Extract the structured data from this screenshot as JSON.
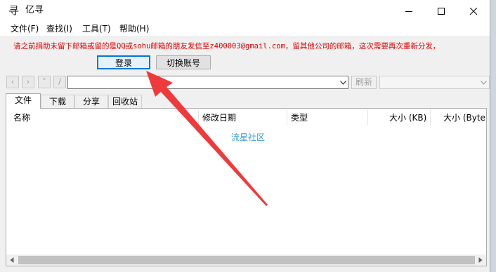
{
  "window": {
    "title": "亿寻",
    "icon": "app-logo-icon"
  },
  "window_controls": {
    "minimize": "minimize-icon",
    "maximize": "maximize-icon",
    "close": "close-icon"
  },
  "menu": [
    {
      "label": "文件(F)"
    },
    {
      "label": "查找(I)"
    },
    {
      "label": "工具(T)"
    },
    {
      "label": "帮助(H)"
    }
  ],
  "notice": {
    "text": "请之前捐助未留下邮箱或留的是QQ或sohu邮箱的朋友发信至z400003@gmail.com，留其他公司的邮箱，这次需要再次重新分发，",
    "color": "#e60000"
  },
  "buttons": {
    "login": "登录",
    "switch_account": "切换账号"
  },
  "toolbar": {
    "back": "‹",
    "forward": "›",
    "up": "˄",
    "root": "/",
    "path_value": "",
    "refresh": "刷新"
  },
  "tabs": [
    {
      "label": "文件",
      "active": true
    },
    {
      "label": "下载"
    },
    {
      "label": "分享"
    },
    {
      "label": "回收站"
    }
  ],
  "columns": [
    {
      "label": "名称"
    },
    {
      "label": "修改日期"
    },
    {
      "label": "类型"
    },
    {
      "label": "大小 (KB)"
    },
    {
      "label": "大小 (Byte"
    }
  ],
  "watermark": "流星社区",
  "annotation": {
    "color": "#f0393a"
  }
}
